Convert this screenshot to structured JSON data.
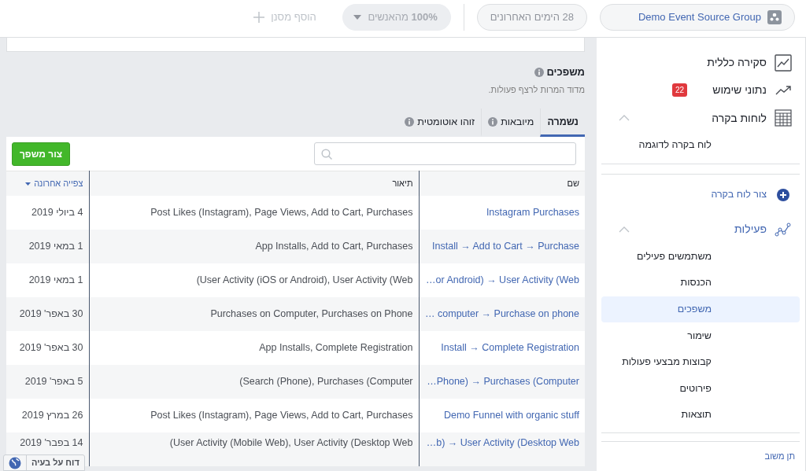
{
  "topbar": {
    "source": {
      "label": "Demo Event Source Group"
    },
    "date_range": {
      "label": "28 הימים האחרונים"
    },
    "audience": {
      "label": "**100%** מהאנשים",
      "disabled": true
    },
    "filter": {
      "label": "הוסף מסנן",
      "disabled": true
    }
  },
  "page": {
    "title": "משפכים",
    "subtitle": "מדוד המרות לרצף פעולות."
  },
  "tabs": [
    {
      "label": "נשמרה",
      "selected": true,
      "info": false
    },
    {
      "label": "מיובאות",
      "selected": false,
      "info": true
    },
    {
      "label": "זוהו אוטומטית",
      "selected": false,
      "info": true
    }
  ],
  "create_button": "צור משפך",
  "table": {
    "columns": [
      {
        "label": "שם",
        "sorted": false
      },
      {
        "label": "תיאור",
        "sorted": false
      },
      {
        "label": "צפייה אחרונה",
        "sorted": true
      }
    ],
    "rows": [
      {
        "name": "Instagram Purchases",
        "description": "Post Likes (Instagram), Page Views, Add to Cart, Purchases",
        "last_viewed": "4 ביולי 2019"
      },
      {
        "name": "Install → Add to Cart → Purchase",
        "description": "App Installs, Add to Cart, Purchases",
        "last_viewed": "1 במאי 2019"
      },
      {
        "name": "…or Android) → User Activity (Web",
        "description": "(User Activity (iOS or Android), User Activity (Web",
        "last_viewed": "1 במאי 2019"
      },
      {
        "name": "… computer → Purchase on phone",
        "description": "Purchases on Computer, Purchases on Phone",
        "last_viewed": "30 באפר' 2019"
      },
      {
        "name": "Install → Complete Registration",
        "description": "App Installs, Complete Registration",
        "last_viewed": "30 באפר' 2019"
      },
      {
        "name": "…Phone) → Purchases (Computer",
        "description": "(Search (Phone), Purchases (Computer",
        "last_viewed": "5 באפר' 2019"
      },
      {
        "name": "Demo Funnel with organic stuff",
        "description": "Post Likes (Instagram), Page Views, Add to Cart, Purchases",
        "last_viewed": "26 במרץ 2019"
      },
      {
        "name": "…b) → User Activity (Desktop Web",
        "description": "(User Activity (Mobile Web), User Activity (Desktop Web",
        "last_viewed": "14 בפבר' 2019"
      }
    ]
  },
  "sidebar": {
    "items": [
      {
        "kind": "nav",
        "label": "סקירה כללית"
      },
      {
        "kind": "nav",
        "label": "נתוני שימוש",
        "badge": "22"
      },
      {
        "kind": "group",
        "label": "לוחות בקרה",
        "active": false,
        "expanded": true,
        "children": [
          {
            "label": "לוח בקרה לדוגמה",
            "selected": false
          }
        ]
      },
      {
        "kind": "action",
        "label": "צור לוח בקרה"
      },
      {
        "kind": "group",
        "label": "פעילות",
        "active": true,
        "expanded": true,
        "children": [
          {
            "label": "משתמשים פעילים",
            "selected": false
          },
          {
            "label": "הכנסות",
            "selected": false
          },
          {
            "label": "משפכים",
            "selected": true
          },
          {
            "label": "שימור",
            "selected": false
          },
          {
            "label": "קבוצות מבצעי פעולות",
            "selected": false
          },
          {
            "label": "פירוטים",
            "selected": false
          },
          {
            "label": "תוצאות",
            "selected": false
          }
        ]
      }
    ],
    "feedback": "תן משוב"
  },
  "report_button": "דוח על בעיה"
}
